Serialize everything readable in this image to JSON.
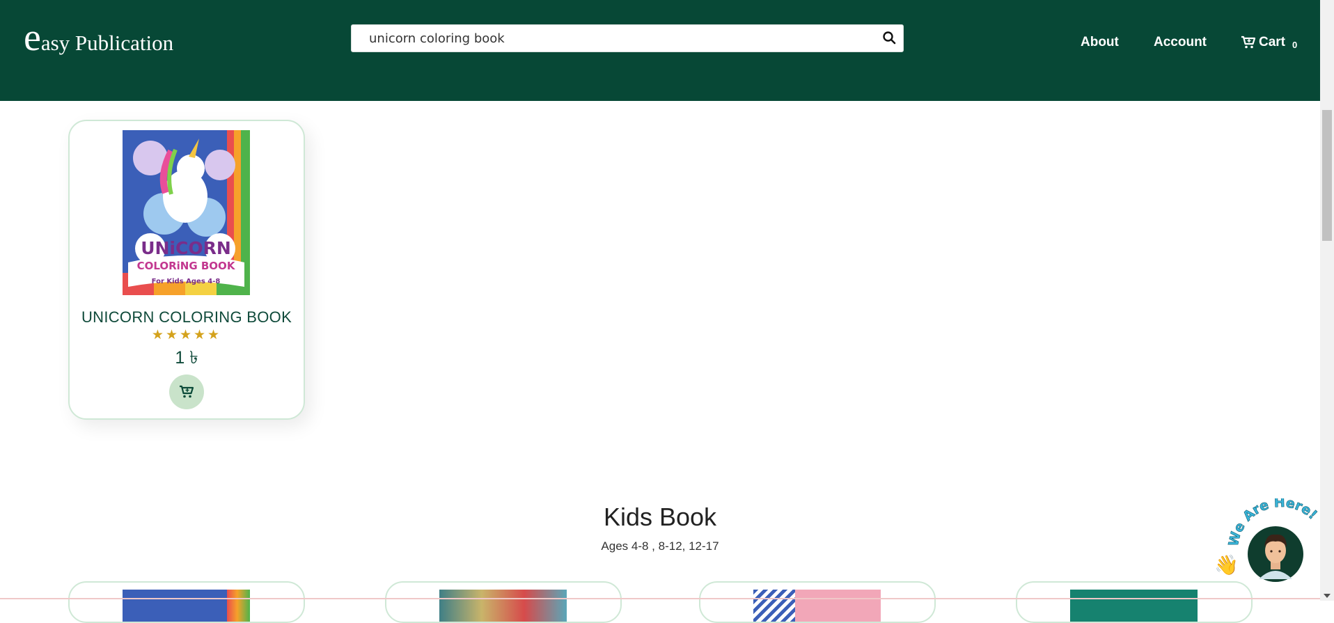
{
  "header": {
    "logo_initial": "e",
    "logo_rest": "asy Publication",
    "search": {
      "value": "unicorn coloring book",
      "placeholder": ""
    },
    "nav": {
      "about": "About",
      "account": "Account",
      "cart": "Cart",
      "cart_count": "0"
    },
    "colors": {
      "background": "#074836",
      "text": "#ffffff"
    }
  },
  "results": [
    {
      "title": "UNICORN COLORING BOOK",
      "rating": "★★★★★",
      "price": "1 ৳",
      "cover": {
        "line1": "UNiCORN",
        "line2": "COLORiNG BOOK",
        "line3": "For Kids Ages 4-8"
      }
    }
  ],
  "section": {
    "title": "Kids Book",
    "subtitle": "Ages 4-8 , 8-12, 12-17"
  },
  "chat_widget": {
    "label": "We Are Here!",
    "wave": "👋"
  },
  "icons": [
    "search-icon",
    "cart-icon",
    "add-to-cart-icon",
    "chat-avatar-icon"
  ]
}
